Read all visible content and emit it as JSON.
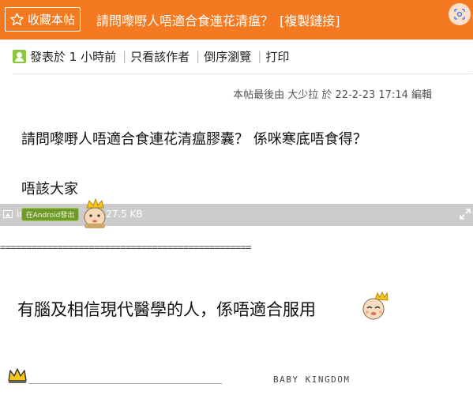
{
  "header": {
    "favorite_label": "收藏本帖",
    "title": "請問嚟嘢人唔適合食連花清瘟？",
    "copy_link": "[複製鏈接]",
    "accent": "#f47920"
  },
  "meta": {
    "posted": "發表於 1 小時前",
    "author_only": "只看該作者",
    "reverse": "倒序瀏覽",
    "print": "打印"
  },
  "post": {
    "edit_note": "本帖最後由 大少拉 於 22-2-23 17:14 編輯",
    "line1": "請問嚟嘢人唔適合食連花清瘟膠囊？ 係咪寒底唔食得？",
    "line2": "唔該大家",
    "image_bar": {
      "name": "image",
      "size": "27.5 KB",
      "badge": "在Android發出"
    },
    "rule": "================================================",
    "closing": "有腦及相信現代醫學的人，係唔適合服用"
  },
  "signature": {
    "line": "______________________________________",
    "brand": "BABY KINGDOM"
  }
}
